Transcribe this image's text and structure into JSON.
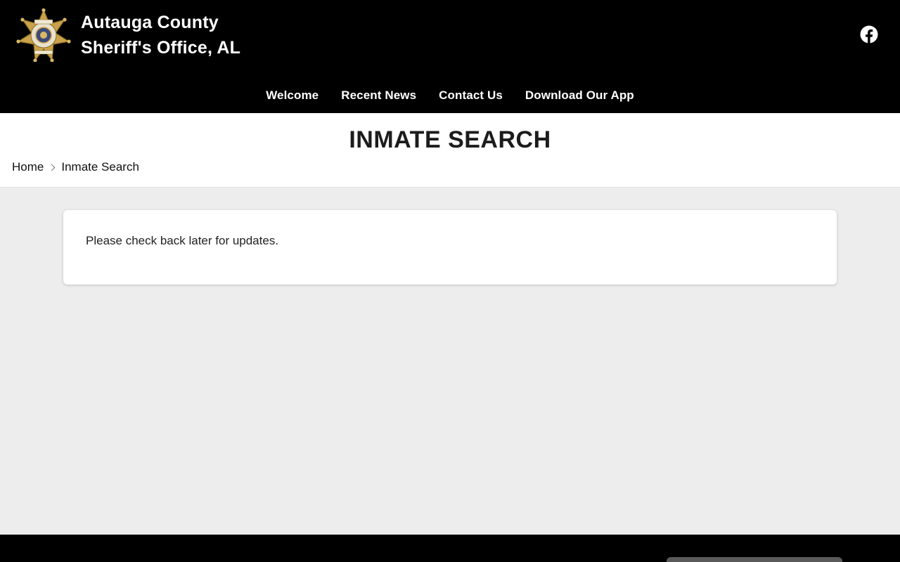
{
  "header": {
    "title_line1": "Autauga County",
    "title_line2": "Sheriff's Office, AL",
    "logo_icon": "sheriff-star-badge-icon",
    "social_icon": "facebook-icon"
  },
  "nav": {
    "items": [
      {
        "label": "Welcome"
      },
      {
        "label": "Recent News"
      },
      {
        "label": "Contact Us"
      },
      {
        "label": "Download Our App"
      }
    ]
  },
  "page": {
    "title": "INMATE SEARCH",
    "breadcrumb": {
      "home": "Home",
      "current": "Inmate Search"
    }
  },
  "content": {
    "message": "Please check back later for updates."
  },
  "colors": {
    "header_bg": "#000000",
    "page_bg": "#ededed",
    "card_bg": "#ffffff",
    "badge_gold": "#c9a24a"
  }
}
